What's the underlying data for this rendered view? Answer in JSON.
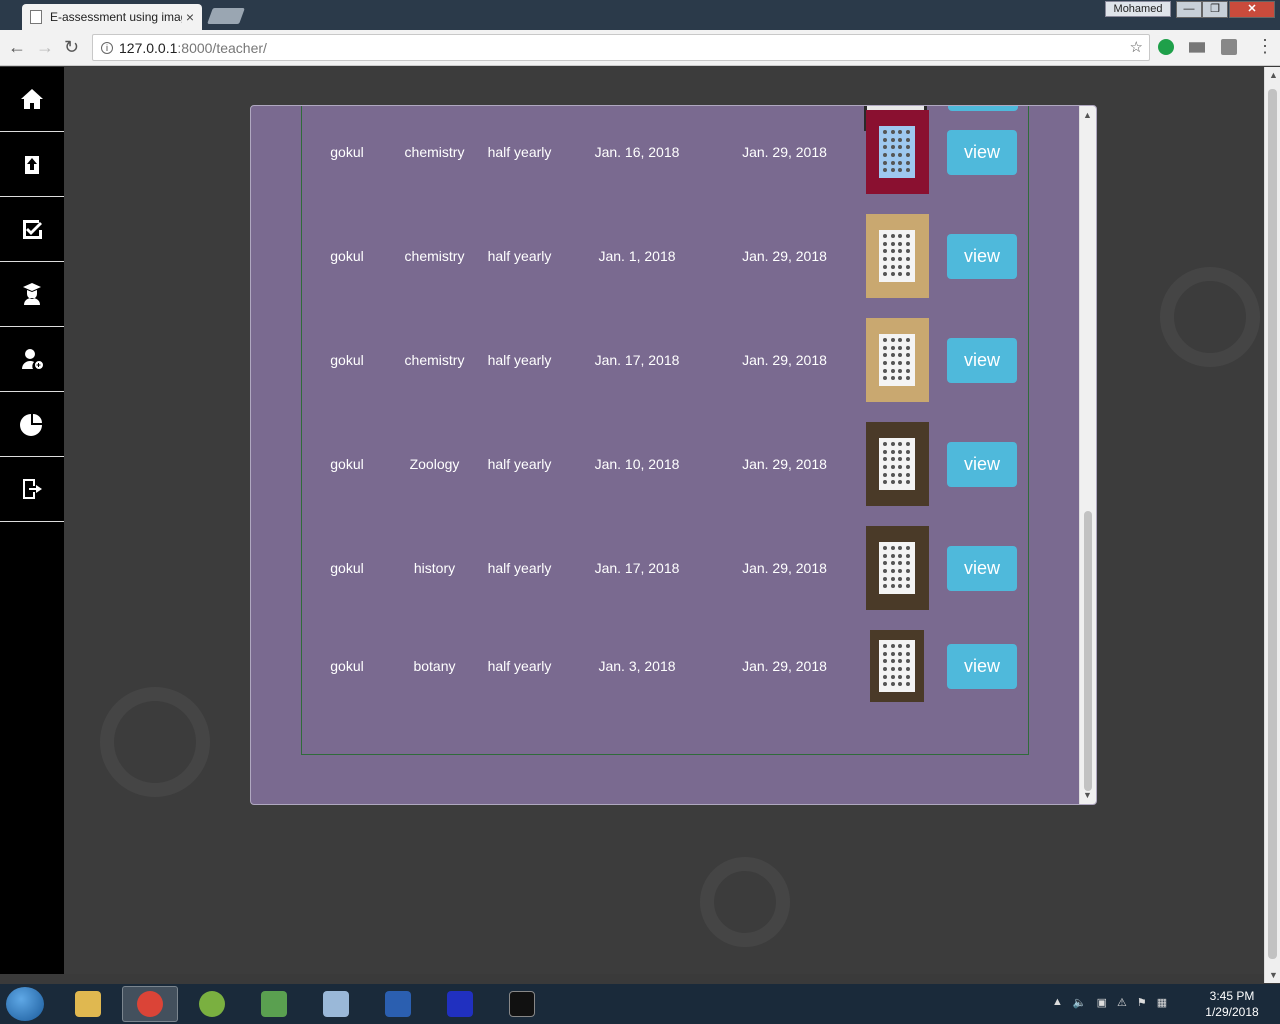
{
  "browser": {
    "tab_title": "E-assessment using imag",
    "tab_close": "×",
    "user_name": "Mohamed",
    "url_host": "127.0.0.1",
    "url_path": ":8000/teacher/",
    "window_buttons": {
      "minimize": "—",
      "maximize": "❐",
      "close": "✕"
    }
  },
  "sidebar": {
    "items": [
      {
        "name": "home"
      },
      {
        "name": "upload"
      },
      {
        "name": "assessment"
      },
      {
        "name": "student"
      },
      {
        "name": "add-user"
      },
      {
        "name": "report"
      },
      {
        "name": "logout"
      }
    ]
  },
  "results": {
    "rows": [
      {
        "student": "gokul",
        "subject": "chemistry",
        "exam": "half yearly",
        "exam_date": "Jan. 16, 2018",
        "evaluated_date": "Jan. 29, 2018",
        "thumb_color": "#8a1030",
        "sheet_color": "#9ec8f0",
        "view_label": "view"
      },
      {
        "student": "gokul",
        "subject": "chemistry",
        "exam": "half yearly",
        "exam_date": "Jan. 1, 2018",
        "evaluated_date": "Jan. 29, 2018",
        "thumb_color": "#c9a870",
        "sheet_color": "#f4f4f4",
        "view_label": "view"
      },
      {
        "student": "gokul",
        "subject": "chemistry",
        "exam": "half yearly",
        "exam_date": "Jan. 17, 2018",
        "evaluated_date": "Jan. 29, 2018",
        "thumb_color": "#c9a870",
        "sheet_color": "#f4f4f4",
        "view_label": "view"
      },
      {
        "student": "gokul",
        "subject": "Zoology",
        "exam": "half yearly",
        "exam_date": "Jan. 10, 2018",
        "evaluated_date": "Jan. 29, 2018",
        "thumb_color": "#4a3a28",
        "sheet_color": "#f4f4f4",
        "view_label": "view"
      },
      {
        "student": "gokul",
        "subject": "history",
        "exam": "half yearly",
        "exam_date": "Jan. 17, 2018",
        "evaluated_date": "Jan. 29, 2018",
        "thumb_color": "#4a3a28",
        "sheet_color": "#f4f4f4",
        "view_label": "view"
      },
      {
        "student": "gokul",
        "subject": "botany",
        "exam": "half yearly",
        "exam_date": "Jan. 3, 2018",
        "evaluated_date": "Jan. 29, 2018",
        "thumb_color": "#4a3a28",
        "sheet_color": "#f4f4f4",
        "view_label": "view"
      }
    ]
  },
  "taskbar": {
    "time": "3:45 PM",
    "date": "1/29/2018",
    "apps": [
      {
        "name": "explorer",
        "color": "#e0b850"
      },
      {
        "name": "chrome",
        "color": "#db4437",
        "active": true
      },
      {
        "name": "chameleon",
        "color": "#7ab040"
      },
      {
        "name": "editor",
        "color": "#5aa050"
      },
      {
        "name": "notepad",
        "color": "#9ab8d8"
      },
      {
        "name": "word",
        "color": "#2b5fb0"
      },
      {
        "name": "app-blue",
        "color": "#2030c0"
      },
      {
        "name": "cmd",
        "color": "#111111"
      }
    ]
  },
  "colors": {
    "panel": "#7a6a90",
    "view_button": "#4fb9db",
    "sidebar": "#000000"
  }
}
